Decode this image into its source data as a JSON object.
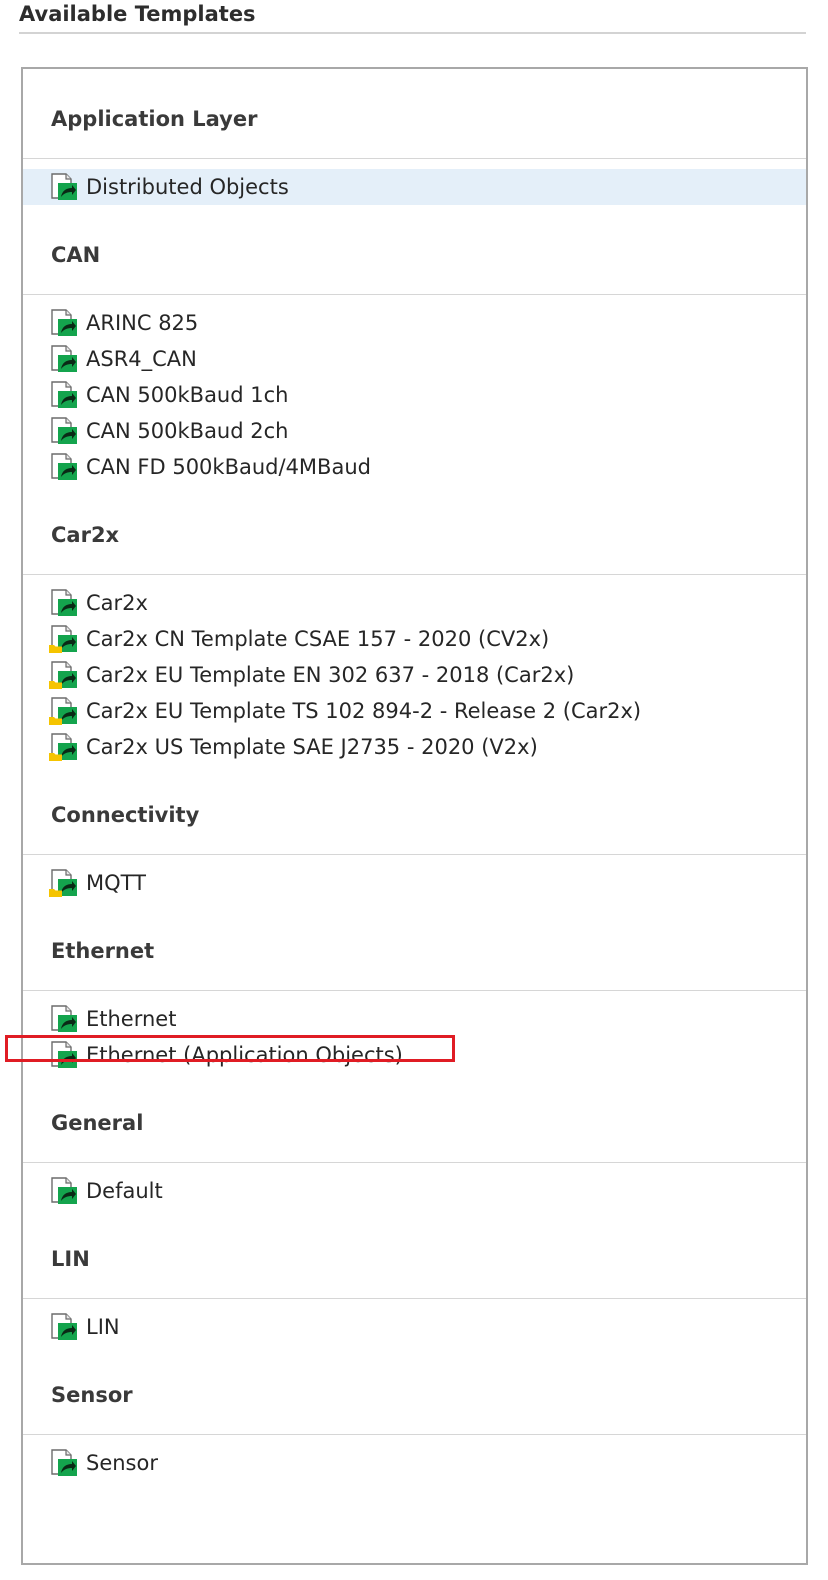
{
  "page": {
    "title": "Available Templates"
  },
  "colors": {
    "selected_bg": "#e4eff9",
    "accent_green": "#14a44d",
    "folder_yellow": "#f5c400",
    "annotation_red": "#e01c24"
  },
  "icons": {
    "template": "template-doc-icon",
    "template_folder": "template-folder-icon"
  },
  "groups": [
    {
      "name": "Application Layer",
      "items": [
        {
          "label": "Distributed Objects",
          "icon": "template",
          "selected": true
        }
      ]
    },
    {
      "name": "CAN",
      "items": [
        {
          "label": "ARINC 825",
          "icon": "template"
        },
        {
          "label": "ASR4_CAN",
          "icon": "template"
        },
        {
          "label": "CAN 500kBaud 1ch",
          "icon": "template"
        },
        {
          "label": "CAN 500kBaud 2ch",
          "icon": "template"
        },
        {
          "label": "CAN FD 500kBaud/4MBaud",
          "icon": "template"
        }
      ]
    },
    {
      "name": "Car2x",
      "items": [
        {
          "label": "Car2x",
          "icon": "template"
        },
        {
          "label": "Car2x CN Template CSAE 157 - 2020 (CV2x)",
          "icon": "template_folder"
        },
        {
          "label": "Car2x EU Template EN 302 637 - 2018 (Car2x)",
          "icon": "template_folder"
        },
        {
          "label": "Car2x EU Template TS 102 894-2 - Release 2 (Car2x)",
          "icon": "template_folder"
        },
        {
          "label": "Car2x US Template SAE J2735 - 2020 (V2x)",
          "icon": "template_folder"
        }
      ]
    },
    {
      "name": "Connectivity",
      "items": [
        {
          "label": "MQTT",
          "icon": "template_folder"
        }
      ]
    },
    {
      "name": "Ethernet",
      "items": [
        {
          "label": "Ethernet",
          "icon": "template"
        },
        {
          "label": "Ethernet (Application Objects)",
          "icon": "template",
          "annotated": true
        }
      ]
    },
    {
      "name": "General",
      "items": [
        {
          "label": "Default",
          "icon": "template"
        }
      ]
    },
    {
      "name": "LIN",
      "items": [
        {
          "label": "LIN",
          "icon": "template"
        }
      ]
    },
    {
      "name": "Sensor",
      "items": [
        {
          "label": "Sensor",
          "icon": "template"
        }
      ]
    }
  ]
}
